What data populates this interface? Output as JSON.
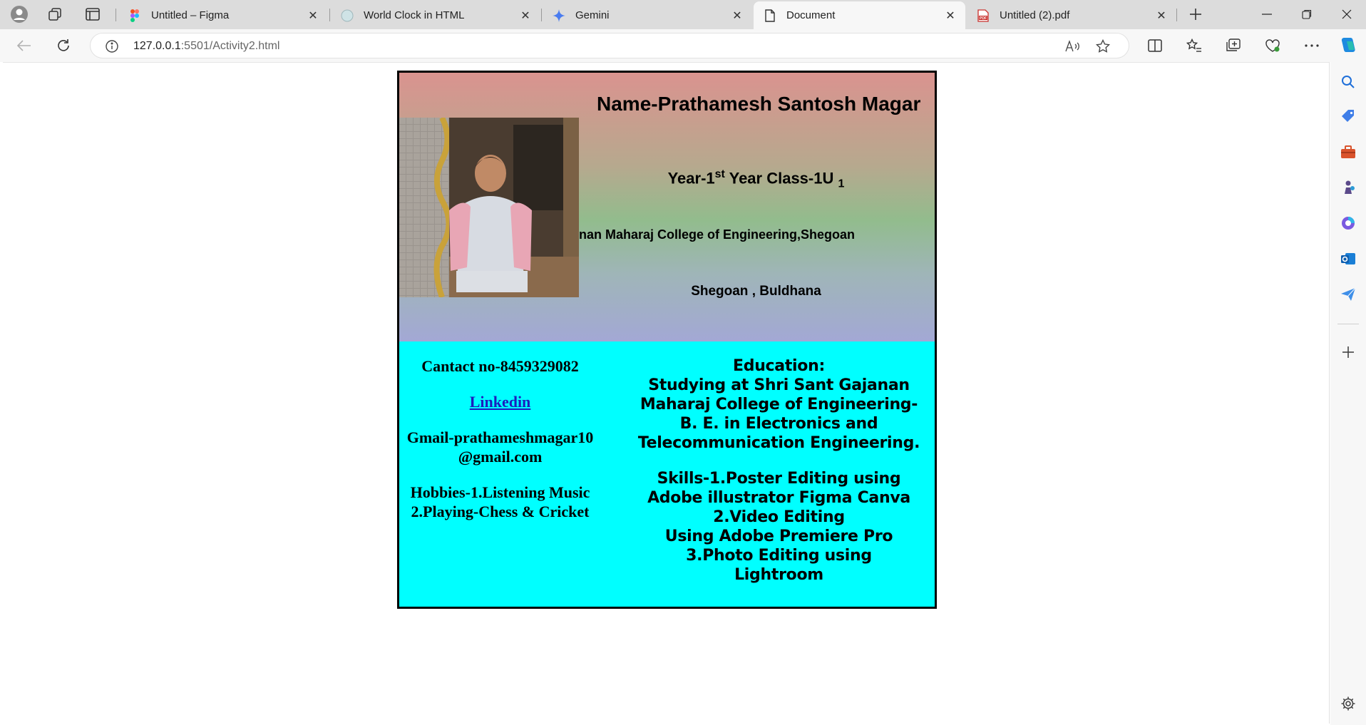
{
  "browser": {
    "tabs": [
      {
        "label": "Untitled – Figma",
        "favicon": "figma-icon"
      },
      {
        "label": "World Clock in HTML",
        "favicon": "globe-icon"
      },
      {
        "label": "Gemini",
        "favicon": "gemini-icon"
      },
      {
        "label": "Document",
        "favicon": "document-icon",
        "active": true
      },
      {
        "label": "Untitled (2).pdf",
        "favicon": "pdf-icon"
      }
    ],
    "address": {
      "host": "127.0.0.1",
      "path": ":5501/Activity2.html"
    }
  },
  "card": {
    "name": "Name-Prathamesh Santosh Magar",
    "year_prefix": "Year-1",
    "year_sup": "st",
    "year_middle": " Year Class-1U ",
    "year_sub": "1",
    "college": "nan Maharaj College of Engineering,Shegoan",
    "address": "Shegoan , Buldhana",
    "contact": "Cantact no-8459329082",
    "linkedin": "Linkedin",
    "gmail_line1": "Gmail-prathameshmagar10",
    "gmail_line2": "@gmail.com",
    "hobbies_line1": "Hobbies-1.Listening Music",
    "hobbies_line2": "2.Playing-Chess & Cricket",
    "education_heading": "Education:",
    "education_lines": [
      "Studying at Shri Sant Gajanan",
      "Maharaj College of Engineering-",
      "B. E. in Electronics and",
      "Telecommunication Engineering."
    ],
    "skills_lines": [
      "Skills-1.Poster Editing using",
      "Adobe illustrator Figma Canva",
      "2.Video Editing",
      "Using Adobe Premiere Pro",
      "3.Photo Editing using",
      "Lightroom"
    ]
  },
  "colors": {
    "page_bottom": "#00ffff",
    "link": "#1d1ebd",
    "gradient_top": "#da938f",
    "gradient_bottom": "#a3a8d5"
  }
}
